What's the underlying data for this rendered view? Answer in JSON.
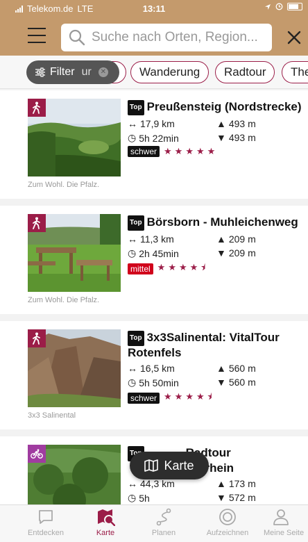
{
  "status": {
    "carrier": "Telekom.de",
    "network": "LTE",
    "time": "13:11"
  },
  "search": {
    "placeholder": "Suche nach Orten, Region..."
  },
  "filter": {
    "label": "Filter",
    "hidden_suffix": "ur"
  },
  "chips": [
    "Wanderung",
    "Radtour",
    "The"
  ],
  "top_label": "Top",
  "tours": [
    {
      "title": "Preußensteig (Nordstrecke)",
      "distance": "17,9 km",
      "duration": "5h 22min",
      "ascent": "493 m",
      "descent": "493 m",
      "difficulty": "schwer",
      "difficulty_color": "#111111",
      "rating": 5,
      "stars": "★★★★★",
      "credit": "Zum Wohl. Die Pfalz.",
      "type": "hiking-icon",
      "badge_color": "#9b1d48"
    },
    {
      "title": "Börsborn - Muhleichenweg",
      "distance": "11,3 km",
      "duration": "2h 45min",
      "ascent": "209 m",
      "descent": "209 m",
      "difficulty": "mittel",
      "difficulty_color": "#d0021b",
      "rating": 4.5,
      "stars": "★★★★⯨",
      "credit": "Zum Wohl. Die Pfalz.",
      "type": "hiking-icon",
      "badge_color": "#9b1d48"
    },
    {
      "title": "3x3Salinental: VitalTour Rotenfels",
      "distance": "16,5 km",
      "duration": "5h 50min",
      "ascent": "560 m",
      "descent": "560 m",
      "difficulty": "schwer",
      "difficulty_color": "#111111",
      "rating": 4.5,
      "stars": "★★★★⯨",
      "credit": "3x3 Salinental",
      "type": "hiking-icon",
      "badge_color": "#9b1d48"
    },
    {
      "title_visible": "Radtour",
      "title_line2": "ttelrhein",
      "distance": "44,3 km",
      "duration": "5h",
      "ascent": "173 m",
      "descent": "572 m",
      "type": "bike-icon",
      "badge_color": "#a03ca0"
    }
  ],
  "map_button": {
    "label": "Karte"
  },
  "tabs": [
    {
      "label": "Entdecken",
      "icon": "chat-icon",
      "active": false
    },
    {
      "label": "Karte",
      "icon": "map-icon",
      "active": true
    },
    {
      "label": "Planen",
      "icon": "route-icon",
      "active": false
    },
    {
      "label": "Aufzeichnen",
      "icon": "record-icon",
      "active": false
    },
    {
      "label": "Meine Seite",
      "icon": "user-icon",
      "active": false
    }
  ],
  "colors": {
    "header": "#c49a6c",
    "accent": "#9b1d48"
  }
}
